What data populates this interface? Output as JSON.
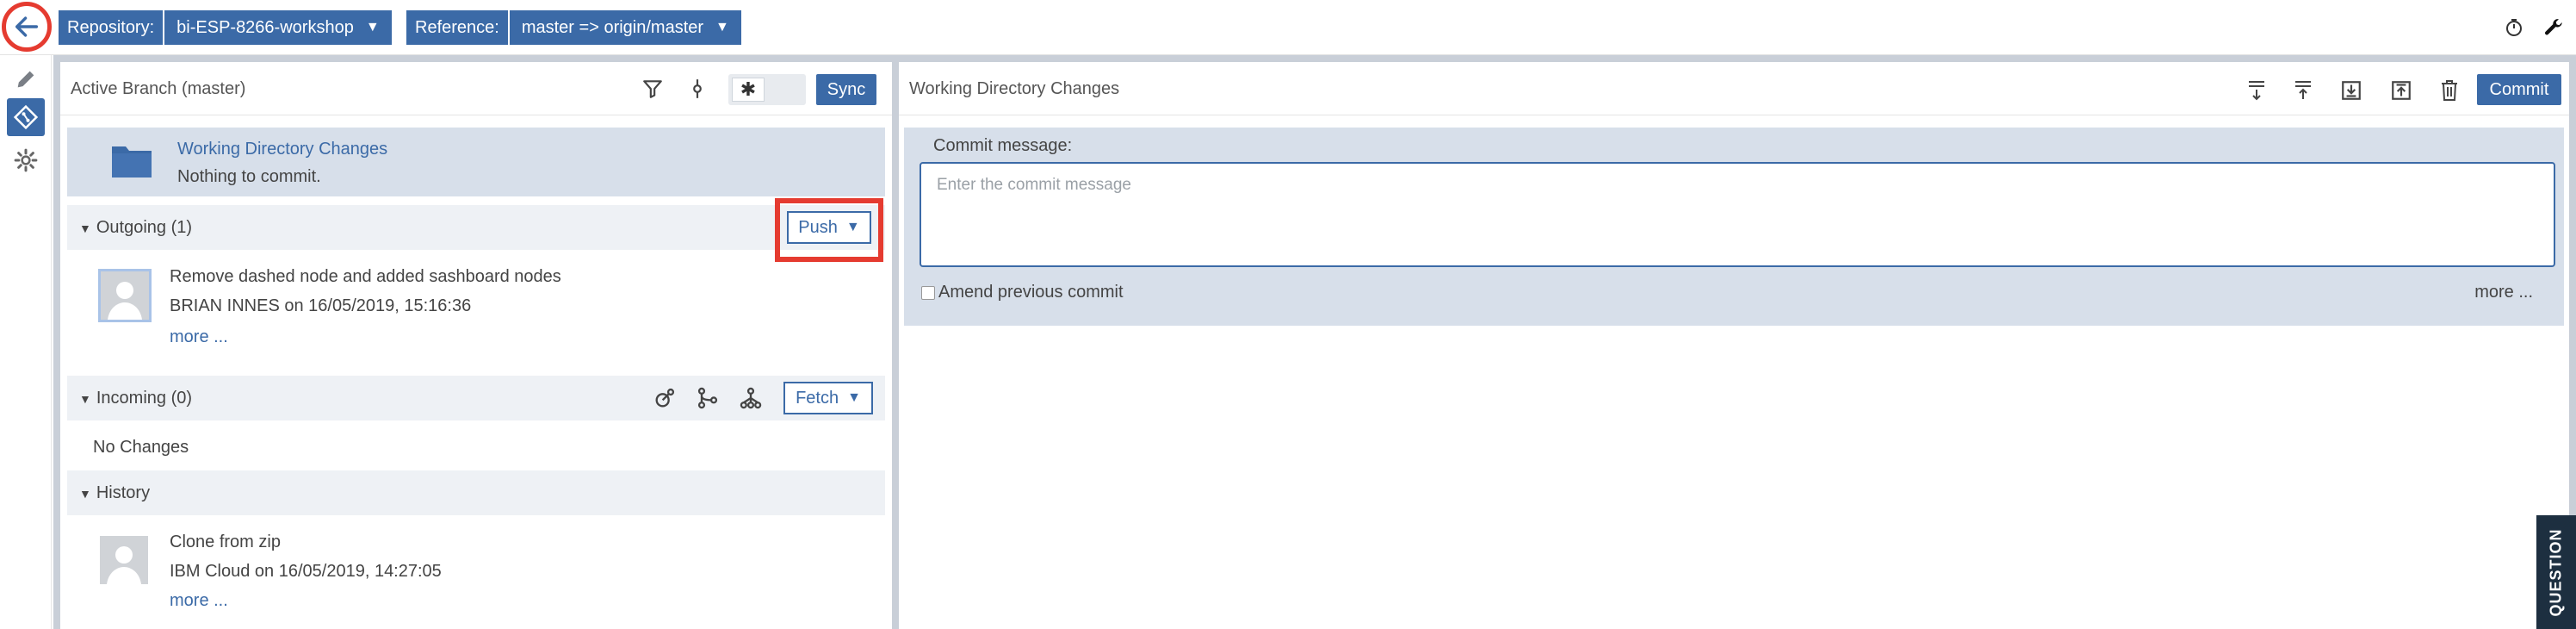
{
  "toolbar": {
    "repository_label": "Repository:",
    "repository_value": "bi-ESP-8266-workshop",
    "reference_label": "Reference:",
    "reference_value": "master => origin/master"
  },
  "left_panel": {
    "title": "Active Branch (master)",
    "sync_label": "Sync",
    "working_dir": {
      "title": "Working Directory Changes",
      "subtitle": "Nothing to commit."
    },
    "outgoing": {
      "label": "Outgoing (1)",
      "push_label": "Push",
      "commit": {
        "message": "Remove dashed node and added sashboard nodes",
        "author_line": "BRIAN INNES on 16/05/2019, 15:16:36",
        "more": "more ..."
      }
    },
    "incoming": {
      "label": "Incoming (0)",
      "fetch_label": "Fetch",
      "empty_text": "No Changes"
    },
    "history": {
      "label": "History",
      "commit": {
        "message": "Clone from zip",
        "author_line": "IBM Cloud on 16/05/2019, 14:27:05",
        "more": "more ..."
      }
    }
  },
  "right_panel": {
    "title": "Working Directory Changes",
    "commit_label": "Commit",
    "commit_message_label": "Commit message:",
    "commit_message_placeholder": "Enter the commit message",
    "commit_message_value": "",
    "amend_label": "Amend previous commit",
    "more": "more ..."
  },
  "question_tab": "QUESTION",
  "colors": {
    "accent": "#3b6aa7",
    "highlight": "#e53b30",
    "panel_selected": "#d7dfea"
  }
}
